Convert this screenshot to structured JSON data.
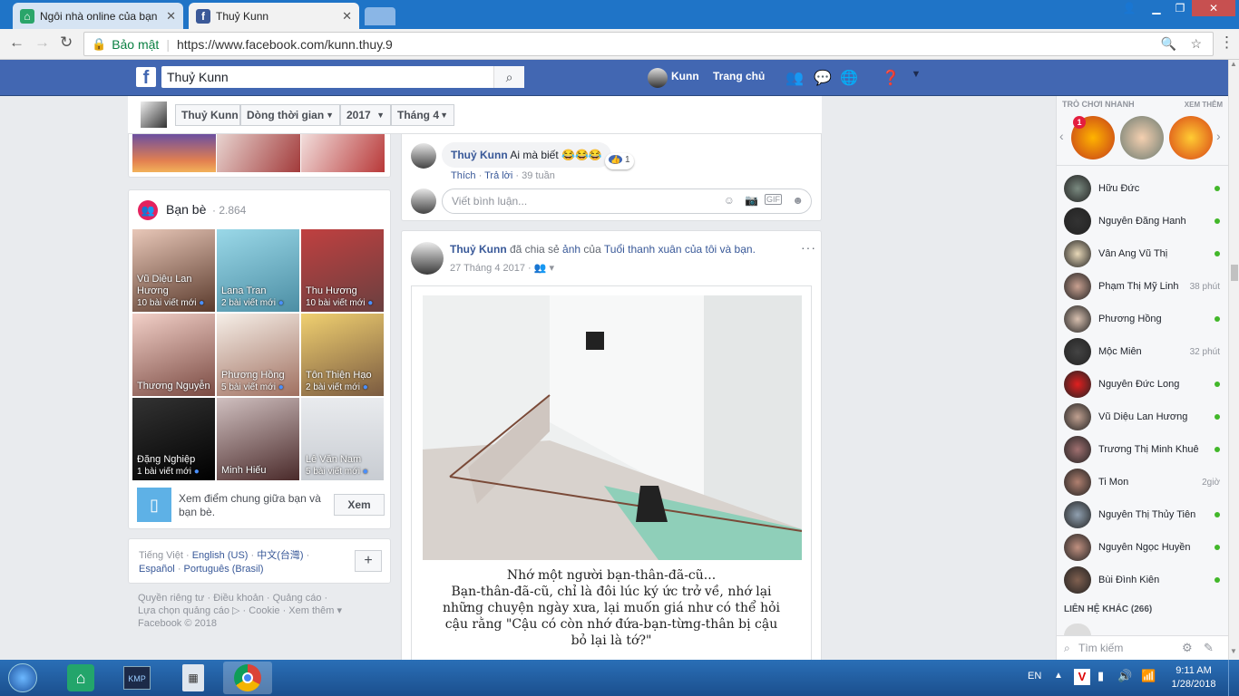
{
  "browser": {
    "tabs": [
      {
        "title": "Ngôi nhà online của bạn"
      },
      {
        "title": "Thuỷ Kunn"
      }
    ],
    "security": "Bảo mật",
    "url": "https://www.facebook.com/kunn.thuy.9"
  },
  "fb": {
    "search_value": "Thuỷ Kunn",
    "user_short": "Kunn",
    "home": "Trang chủ"
  },
  "subnav": {
    "name": "Thuỷ Kunn",
    "timeline": "Dòng thời gian",
    "year": "2017",
    "month": "Tháng 4"
  },
  "friends": {
    "title": "Bạn bè",
    "count": "· 2.864",
    "items": [
      {
        "name": "Vũ Diệu Lan Hương",
        "posts": "10 bài viết mới"
      },
      {
        "name": "Lana Tran",
        "posts": "2 bài viết mới"
      },
      {
        "name": "Thu Hương",
        "posts": "10 bài viết mới"
      },
      {
        "name": "Thương Nguyễn",
        "posts": ""
      },
      {
        "name": "Phương Hồng",
        "posts": "5 bài viết mới"
      },
      {
        "name": "Tôn Thiện Hạo",
        "posts": "2 bài viết mới"
      },
      {
        "name": "Đặng Nghiệp",
        "posts": "1 bài viết mới"
      },
      {
        "name": "Minh Hiếu",
        "posts": ""
      },
      {
        "name": "Lê Văn Nam",
        "posts": "5 bài viết mới"
      }
    ],
    "mutual_text": "Xem điểm chung giữa bạn và bạn bè.",
    "mutual_button": "Xem"
  },
  "languages": {
    "current": "Tiếng Việt",
    "others": [
      "English (US)",
      "中文(台灣)",
      "Español",
      "Português (Brasil)"
    ],
    "add": "+"
  },
  "footer": {
    "links": [
      "Quyền riêng tư",
      "Điều khoản",
      "Quảng cáo",
      "Lựa chọn quảng cáo",
      "Cookie",
      "Xem thêm"
    ],
    "copyright": "Facebook © 2018"
  },
  "comment": {
    "author": "Thuỷ Kunn",
    "text": "Ai mà biết 😂😂😂",
    "like": "Thích",
    "reply": "Trả lời",
    "time": "39 tuần",
    "reactions": "1",
    "placeholder": "Viết bình luận..."
  },
  "post": {
    "author": "Thuỷ Kunn",
    "shared_text": "đã chia sẻ",
    "photo_word": "ảnh",
    "of": "của",
    "page": "Tuổi thanh xuân của tôi và bạn.",
    "date": "27 Tháng 4 2017",
    "caption": [
      "Nhớ một người bạn-thân-đã-cũ...",
      "Bạn-thân-đã-cũ, chỉ là đôi lúc ký ức trở về, nhớ lại",
      "những chuyện ngày xưa, lại muốn giá như có thể hỏi",
      "cậu rằng \"Cậu có còn nhớ đứa-bạn-từng-thân bị cậu",
      "bỏ lại là tớ?\""
    ]
  },
  "sidebar": {
    "games_title": "TRÒ CHƠI NHANH",
    "see_more": "XEM THÊM",
    "game_badge": "1",
    "contacts": [
      {
        "name": "Hữu Đức",
        "status": ""
      },
      {
        "name": "Nguyễn Đăng Hanh",
        "status": ""
      },
      {
        "name": "Vân Ang Vũ Thị",
        "status": ""
      },
      {
        "name": "Phạm Thị Mỹ Linh",
        "status": "38 phút"
      },
      {
        "name": "Phương Hồng",
        "status": ""
      },
      {
        "name": "Mộc Miên",
        "status": "32 phút"
      },
      {
        "name": "Nguyễn Đức Long",
        "status": ""
      },
      {
        "name": "Vũ Diệu Lan Hương",
        "status": ""
      },
      {
        "name": "Trương Thị Minh Khuê",
        "status": ""
      },
      {
        "name": "Ti Mon",
        "status": "2giờ"
      },
      {
        "name": "Nguyễn Thị Thủy Tiên",
        "status": ""
      },
      {
        "name": "Nguyễn Ngọc Huyền",
        "status": ""
      },
      {
        "name": "Bùi Đình Kiên",
        "status": ""
      }
    ],
    "other_contacts": "LIÊN HỆ KHÁC (266)",
    "search_placeholder": "Tìm kiếm"
  },
  "taskbar": {
    "lang": "EN",
    "time": "9:11 AM",
    "date": "1/28/2018"
  }
}
